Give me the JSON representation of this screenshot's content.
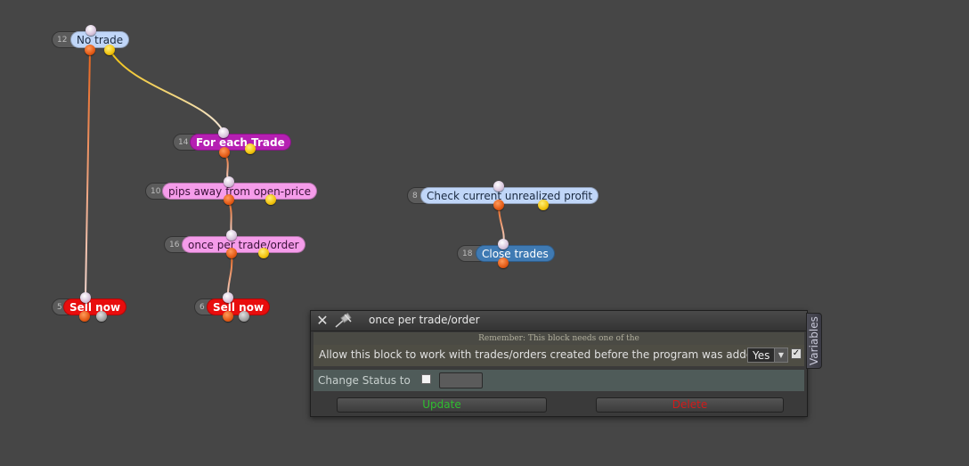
{
  "nodes": [
    {
      "id": "no-trade",
      "number": "12",
      "label": "No trade",
      "color": "#c0d6f8",
      "text": "#1a2a40"
    },
    {
      "id": "for-each-trade",
      "number": "14",
      "label": "For each Trade",
      "color": "#b51fb2",
      "text": "#ffffff"
    },
    {
      "id": "pips-away",
      "number": "10",
      "label": "pips away from open-price",
      "color": "#f59cea",
      "text": "#3a1038"
    },
    {
      "id": "once-per-trade",
      "number": "16",
      "label": "once per trade/order",
      "color": "#f59cea",
      "text": "#3a1038"
    },
    {
      "id": "sell-now-a",
      "number": "5",
      "label": "Sell now",
      "color": "#e80d0d",
      "text": "#ffffff"
    },
    {
      "id": "sell-now-b",
      "number": "6",
      "label": "Sell now",
      "color": "#e80d0d",
      "text": "#ffffff"
    },
    {
      "id": "check-profit",
      "number": "8",
      "label": "Check current unrealized profit",
      "color": "#c0d6f8",
      "text": "#1a2a40"
    },
    {
      "id": "close-trades",
      "number": "18",
      "label": "Close trades",
      "color": "#3f7ab3",
      "text": "#ffffff"
    }
  ],
  "panel": {
    "title": "once per trade/order",
    "notice": "Remember: This block needs one of the",
    "allow_label": "Allow this block to work with trades/orders created before the program was added?",
    "allow_value": "Yes",
    "change_status_label": "Change Status to",
    "update_label": "Update",
    "delete_label": "Delete",
    "close_icon": "close-icon",
    "pin_icon": "pin-icon"
  },
  "variables_tab": "Variables",
  "colors": {
    "background": "#464646",
    "wire_orange": "#e8641c",
    "wire_yellow": "#f2d24a",
    "update": "#2fbe2f",
    "delete": "#d21a1a"
  }
}
